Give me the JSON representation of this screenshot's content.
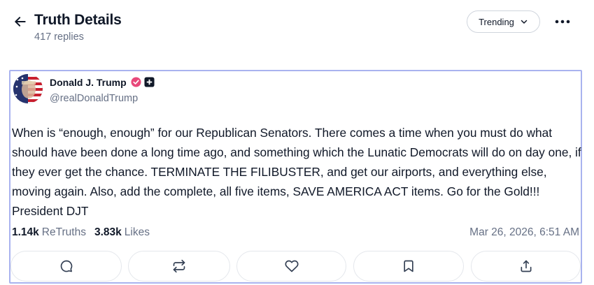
{
  "header": {
    "title": "Truth Details",
    "reply_count": "417 replies",
    "back_icon": "arrow-left-icon",
    "sort_label": "Trending",
    "more_icon": "more-horizontal-icon"
  },
  "post": {
    "author_name": "Donald J. Trump",
    "handle": "@realDonaldTrump",
    "verified_color": "#e8487a",
    "text": "When is “enough, enough” for our Republican Senators. There comes a time when you must do what should have been done a long time ago, and something which the Lunatic Democrats will do on day one, if they ever get the chance. TERMINATE THE FILIBUSTER, and get our airports, and everything else, moving again. Also, add the complete, all five items, SAVE AMERICA ACT items. Go for the Gold!!! President DJT",
    "retruths_count": "1.14k",
    "retruths_label": "ReTruths",
    "likes_count": "3.83k",
    "likes_label": "Likes",
    "date": "Mar 26, 2026, 6:51 AM"
  },
  "actions": [
    {
      "icon": "comment-icon"
    },
    {
      "icon": "retruth-icon"
    },
    {
      "icon": "heart-icon"
    },
    {
      "icon": "bookmark-icon"
    },
    {
      "icon": "share-icon"
    }
  ],
  "colors": {
    "post_border": "#a9b3ef",
    "muted_text": "#667085",
    "primary_text": "#101828"
  }
}
